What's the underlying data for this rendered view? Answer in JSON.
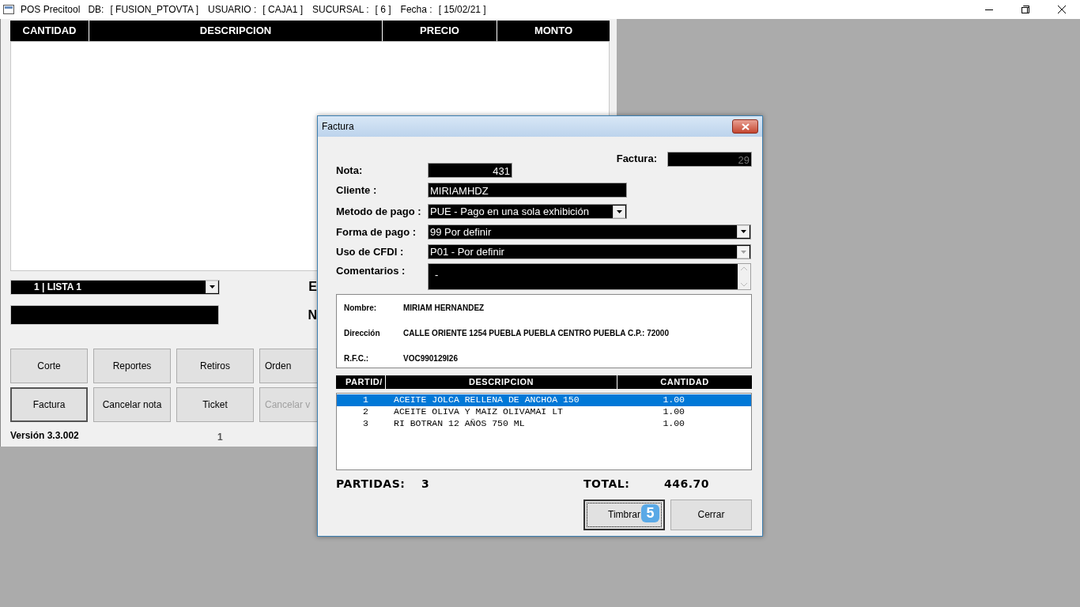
{
  "window": {
    "title": "POS Precitool",
    "info": [
      {
        "label": "DB:",
        "value": "[ FUSION_PTOVTA ]"
      },
      {
        "label": "USUARIO :",
        "value": "[ CAJA1 ]"
      },
      {
        "label": "SUCURSAL :",
        "value": "[ 6 ]"
      },
      {
        "label": "Fecha :",
        "value": "[ 15/02/21 ]"
      }
    ]
  },
  "sale_table": {
    "columns": [
      "CANTIDAD",
      "DESCRIPCION",
      "PRECIO",
      "MONTO"
    ]
  },
  "price_list": {
    "value": "1  | LISTA 1"
  },
  "side_labels": [
    "E",
    "N"
  ],
  "buttons": [
    {
      "label": "Corte",
      "disabled": false,
      "focused": false
    },
    {
      "label": "Reportes",
      "disabled": false,
      "focused": false
    },
    {
      "label": "Retiros",
      "disabled": false,
      "focused": false
    },
    {
      "label": "Orden",
      "disabled": false,
      "focused": false
    },
    {
      "label": "Factura",
      "disabled": false,
      "focused": true
    },
    {
      "label": "Cancelar nota",
      "disabled": false,
      "focused": false
    },
    {
      "label": "Ticket",
      "disabled": false,
      "focused": false
    },
    {
      "label": "Cancelar v",
      "disabled": true,
      "focused": false
    }
  ],
  "version": "Versión 3.3.002",
  "counter": "1",
  "dialog": {
    "title": "Factura",
    "factura": {
      "label": "Factura:",
      "value": "29"
    },
    "nota": {
      "label": "Nota:",
      "value": "431"
    },
    "cliente": {
      "label": "Cliente :",
      "value": "MIRIAMHDZ"
    },
    "metodo_pago": {
      "label": "Metodo de pago :",
      "value": "PUE - Pago en una sola exhibición",
      "disabled": false
    },
    "forma_pago": {
      "label": "Forma de pago :",
      "value": "99 Por definir",
      "disabled": false
    },
    "uso_cfdi": {
      "label": "Uso de CFDI :",
      "value": "P01 - Por definir",
      "disabled": true
    },
    "comentarios": {
      "label": "Comentarios :",
      "value": "-"
    },
    "customer": [
      {
        "label": "Nombre:",
        "value": "MIRIAM HERNANDEZ"
      },
      {
        "label": "Dirección",
        "value": "CALLE ORIENTE 1254  PUEBLA  PUEBLA CENTRO PUEBLA  C.P.: 72000"
      },
      {
        "label": "R.F.C.:",
        "value": "VOC990129I26"
      }
    ],
    "table": {
      "columns": [
        "PARTID/",
        "DESCRIPCION",
        "CANTIDAD"
      ],
      "rows": [
        {
          "partida": "1",
          "descripcion": "ACEITE JOLCA RELLENA DE ANCHOA 150",
          "cantidad": "1.00",
          "selected": true
        },
        {
          "partida": "2",
          "descripcion": "ACEITE OLIVA Y MAIZ OLIVAMAI LT",
          "cantidad": "1.00",
          "selected": false
        },
        {
          "partida": "3",
          "descripcion": "RI BOTRAN 12 AÑOS 750 ML",
          "cantidad": "1.00",
          "selected": false
        }
      ]
    },
    "partidas": {
      "label": "PARTIDAS:",
      "value": "3"
    },
    "total": {
      "label": "TOTAL:",
      "value": "446.70"
    },
    "buttons": [
      {
        "label": "Timbrar",
        "focused": true,
        "badge": "5"
      },
      {
        "label": "Cerrar",
        "focused": false
      }
    ]
  }
}
